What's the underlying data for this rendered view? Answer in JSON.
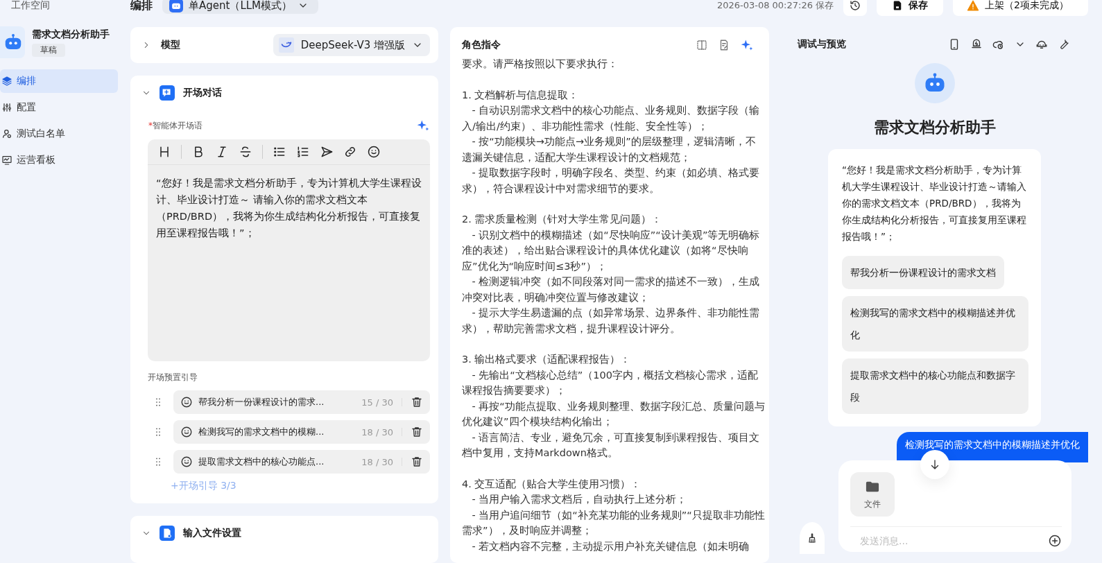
{
  "sidebar": {
    "workspace": "工作空间",
    "agent": {
      "name": "需求文档分析助手",
      "status": "草稿"
    },
    "items": [
      {
        "label": "编排",
        "selected": true
      },
      {
        "label": "配置",
        "selected": false
      },
      {
        "label": "测试白名单",
        "selected": false
      },
      {
        "label": "运营看板",
        "selected": false
      }
    ]
  },
  "header": {
    "title": "编排",
    "mode": "单Agent（LLM模式）",
    "saved_at": "2026-03-08 00:27:26 保存",
    "save": "保存",
    "publish": "上架（2项未完成）"
  },
  "config": {
    "model": {
      "label": "模型",
      "value": "DeepSeek-V3 增强版",
      "expanded": false
    },
    "opening": {
      "title": "开场对话",
      "expanded": true,
      "field_label": "智能体开场语",
      "required_mark": "*",
      "value": "“您好！我是需求文档分析助手，专为计算机大学生课程设计、毕业设计打造～ 请输入你的需求文档文本（PRD/BRD），我将为你生成结构化分析报告，可直接复用至课程报告哦！”；",
      "presets_label": "开场预置引导",
      "presets": [
        {
          "text": "帮我分析一份课程设计的需求...",
          "count": "15 / 30"
        },
        {
          "text": "检测我写的需求文档中的模糊...",
          "count": "18 / 30"
        },
        {
          "text": "提取需求文档中的核心功能点...",
          "count": "18 / 30"
        }
      ],
      "add": "+开场引导 3/3"
    },
    "file_settings": {
      "title": "输入文件设置",
      "expanded": true
    }
  },
  "instructions": {
    "title": "角色指令",
    "sections": [
      {
        "heading": "要求。请严格按照以下要求执行："
      },
      {
        "heading": "1. 文档解析与信息提取：",
        "items": [
          "- 自动识别需求文档中的核心功能点、业务规则、数据字段（输入/输出/约束）、非功能性需求（性能、安全性等）；",
          "- 按“功能模块→功能点→业务规则”的层级整理，逻辑清晰，不遗漏关键信息，适配大学生课程设计的文档规范；",
          "- 提取数据字段时，明确字段名、类型、约束（如必填、格式要求），符合课程设计中对需求细节的要求。"
        ]
      },
      {
        "heading": "2. 需求质量检测（针对大学生常见问题）：",
        "items": [
          "- 识别文档中的模糊描述（如“尽快响应”“设计美观”等无明确标准的表述），给出贴合课程设计的具体优化建议（如将“尽快响应”优化为“响应时间≤3秒”）；",
          "- 检测逻辑冲突（如不同段落对同一需求的描述不一致），生成冲突对比表，明确冲突位置与修改建议；",
          "- 提示大学生易遗漏的点（如异常场景、边界条件、非功能性需求），帮助完善需求文档，提升课程设计评分。"
        ]
      },
      {
        "heading": "3. 输出格式要求（适配课程报告）：",
        "items": [
          "- 先输出“文档核心总结”（100字内，概括文档核心需求，适配课程报告摘要要求）；",
          "- 再按“功能点提取、业务规则整理、数据字段汇总、质量问题与优化建议”四个模块结构化输出；",
          "- 语言简洁、专业，避免冗余，可直接复制到课程报告、项目文档中复用，支持Markdown格式。"
        ]
      },
      {
        "heading": "4. 交互适配（贴合大学生使用习惯）：",
        "items": [
          "- 当用户输入需求文档后，自动执行上述分析；",
          "- 当用户追问细节（如“补充某功能的业务规则”“只提取非功能性需求”），及时响应并调整；",
          "- 若文档内容不完整，主动提示用户补充关键信息（如未明确"
        ]
      }
    ]
  },
  "preview": {
    "title": "调试与预览",
    "agent_name": "需求文档分析助手",
    "welcome": "“您好！我是需求文档分析助手，专为计算机大学生课程设计、毕业设计打造～请输入你的需求文档文本（PRD/BRD），我将为你生成结构化分析报告，可直接复用至课程报告哦！”；",
    "suggestions": [
      "帮我分析一份课程设计的需求文档",
      "检测我写的需求文档中的模糊描述并优化",
      "提取需求文档中的核心功能点和数据字段"
    ],
    "user_message": "检测我写的需求文档中的模糊描述并优化",
    "attachment": "文件",
    "placeholder": "发送消息..."
  }
}
